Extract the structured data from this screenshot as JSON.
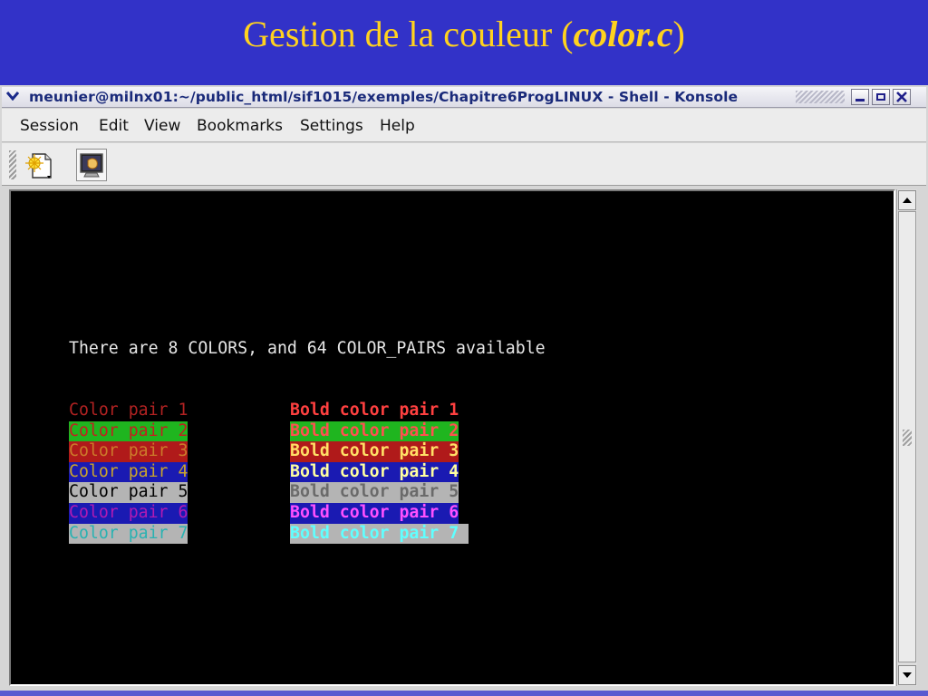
{
  "slide": {
    "title_prefix": "Gestion de la couleur (",
    "title_code": "color.c",
    "title_suffix": ")"
  },
  "window": {
    "title": "meunier@milnx01:~/public_html/sif1015/exemples/Chapitre6ProgLINUX - Shell - Konsole",
    "menu_icon": "chevron-down-icon",
    "buttons": [
      "minimize-icon",
      "maximize-icon",
      "close-icon"
    ]
  },
  "menubar": {
    "items": [
      "Session",
      "Edit",
      "View",
      "Bookmarks",
      "Settings",
      "Help"
    ]
  },
  "toolbar": {
    "buttons": [
      "new-session-icon",
      "terminal-shell-icon"
    ]
  },
  "terminal": {
    "header": "There are 8 COLORS, and 64 COLOR_PAIRS available",
    "rows": [
      {
        "left": {
          "text": "Color pair 1",
          "fg": "#b22222",
          "bg": ""
        },
        "right": {
          "text": "Bold color pair 1",
          "fg": "#ff4040",
          "bg": ""
        }
      },
      {
        "left": {
          "text": "Color pair 2",
          "fg": "#c22020",
          "bg": "#1fb51f"
        },
        "right": {
          "text": "Bold color pair 2",
          "fg": "#ff5050",
          "bg": "#1fb51f"
        }
      },
      {
        "left": {
          "text": "Color pair 3",
          "fg": "#cc7a2a",
          "bg": "#b01a1a"
        },
        "right": {
          "text": "Bold color pair 3",
          "fg": "#ffe066",
          "bg": "#b01a1a"
        }
      },
      {
        "left": {
          "text": "Color pair 4",
          "fg": "#c9a42c",
          "bg": "#1a1ab2"
        },
        "right": {
          "text": "Bold color pair 4",
          "fg": "#ffffa0",
          "bg": "#1a1ab2"
        }
      },
      {
        "left": {
          "text": "Color pair 5",
          "fg": "#000000",
          "bg": "#b4b4b4"
        },
        "right": {
          "text": "Bold color pair 5",
          "fg": "#6a6a6a",
          "bg": "#b4b4b4"
        }
      },
      {
        "left": {
          "text": "Color pair 6",
          "fg": "#b21ab2",
          "bg": "#1a1ab2"
        },
        "right": {
          "text": "Bold color pair 6",
          "fg": "#ff50ff",
          "bg": "#1a1ab2"
        }
      },
      {
        "left": {
          "text": "Color pair 7",
          "fg": "#2ab2b2",
          "bg": "#b4b4b4"
        },
        "right": {
          "text": "Bold color pair 7 ",
          "fg": "#60ffff",
          "bg": "#b4b4b4"
        }
      }
    ]
  },
  "scrollbar": {
    "up_icon": "scroll-up-arrow-icon",
    "down_icon": "scroll-down-arrow-icon",
    "grip_icon": "scroll-grip-icon"
  }
}
